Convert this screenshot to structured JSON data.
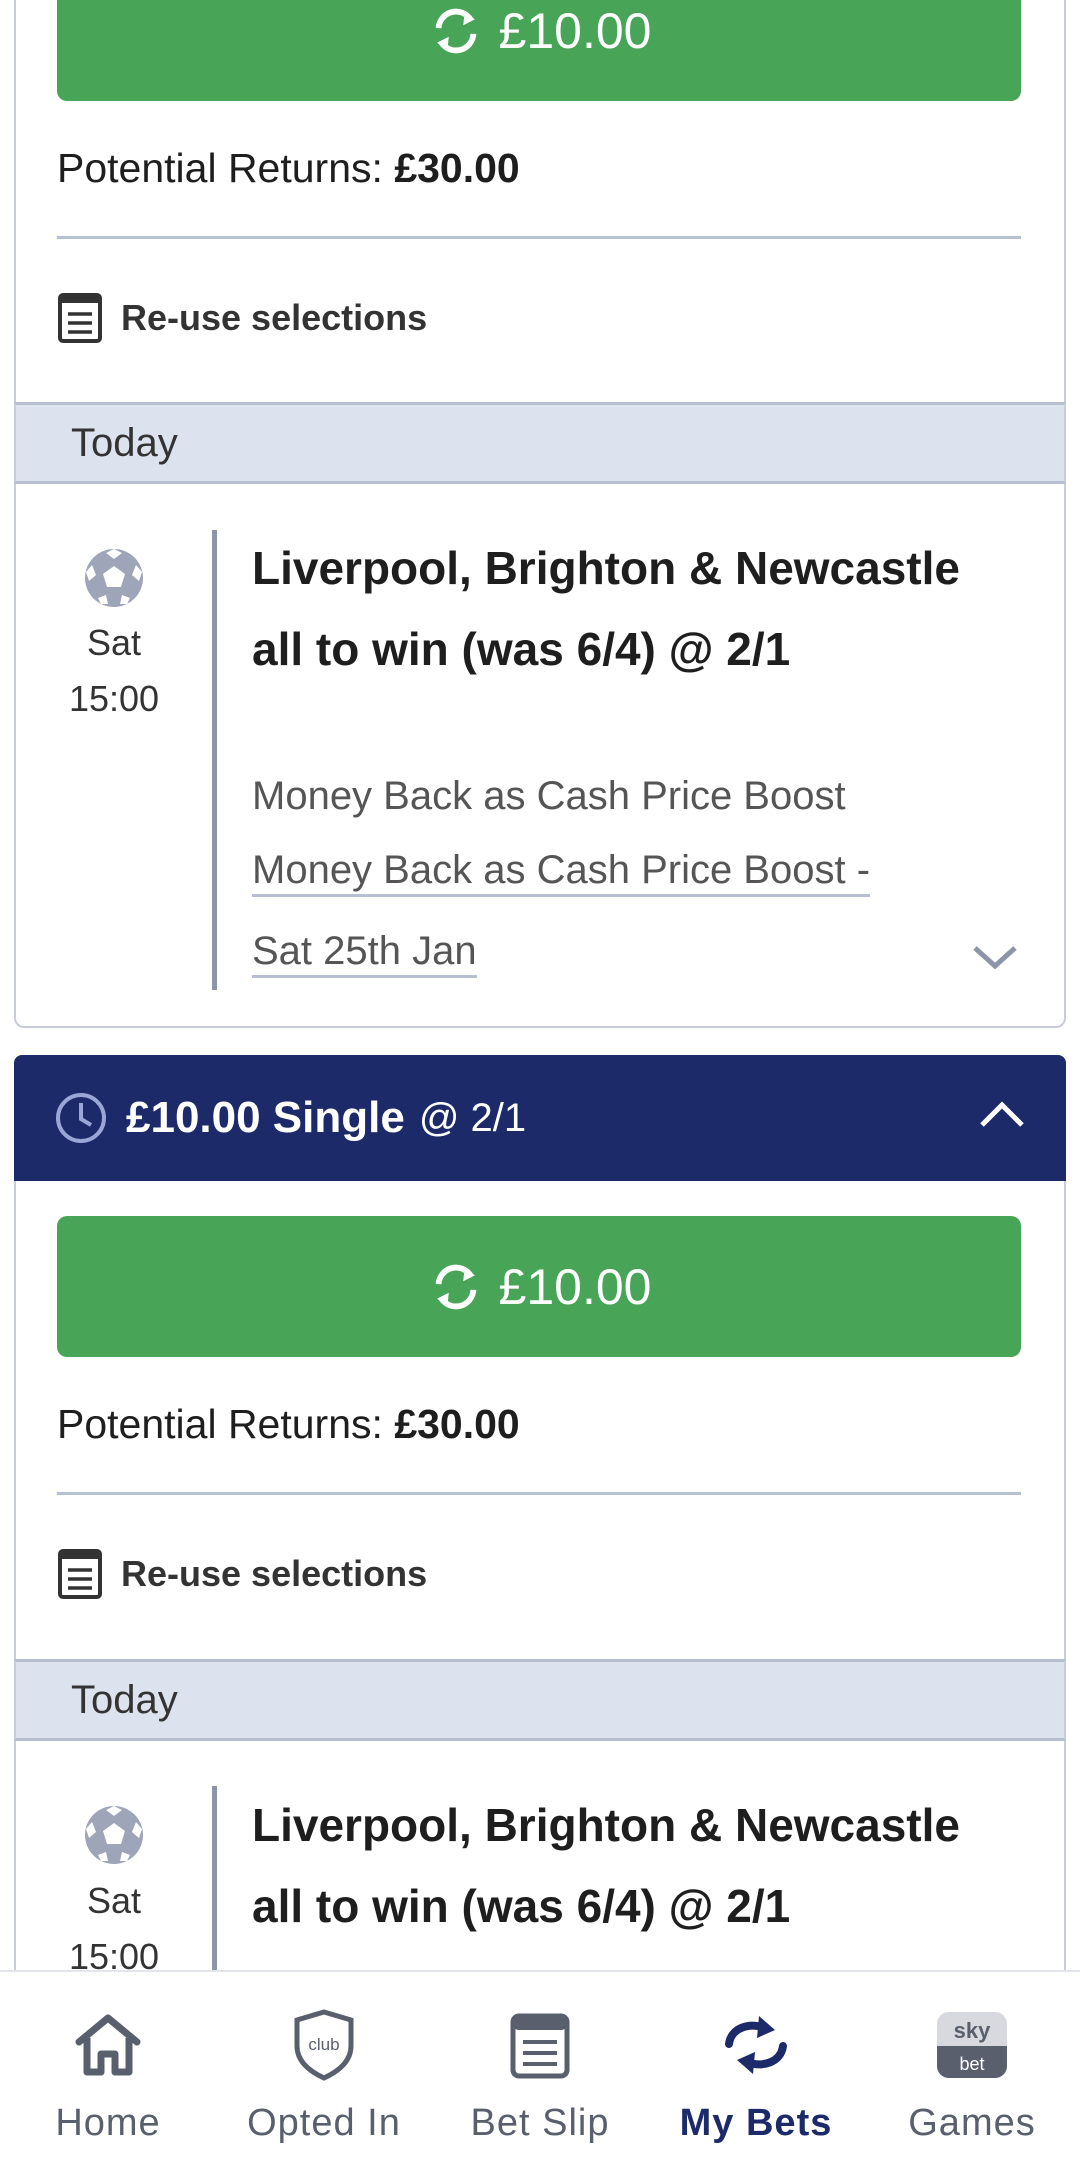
{
  "bets": [
    {
      "cashout_amount": "£10.00",
      "returns_label": "Potential Returns:",
      "returns_value": "£30.00",
      "reuse_label": "Re-use selections",
      "day_header": "Today",
      "selection": {
        "day": "Sat",
        "time": "15:00",
        "title": "Liverpool, Brighton & Newcastle all to win (was 6/4) @ 2/1",
        "market": "Money Back as Cash Price Boost",
        "event_link": "Money Back as Cash Price Boost - Sat 25th Jan"
      }
    },
    {
      "header_stake": "£10.00 Single",
      "header_odds": "@ 2/1",
      "cashout_amount": "£10.00",
      "returns_label": "Potential Returns:",
      "returns_value": "£30.00",
      "reuse_label": "Re-use selections",
      "day_header": "Today",
      "selection": {
        "day": "Sat",
        "time": "15:00",
        "title": "Liverpool, Brighton & Newcastle all to win (was 6/4) @ 2/1"
      }
    }
  ],
  "nav": {
    "items": [
      {
        "label": "Home",
        "icon": "home-icon"
      },
      {
        "label": "Opted In",
        "icon": "club-shield-icon",
        "icon_text": "club"
      },
      {
        "label": "Bet Slip",
        "icon": "bet-slip-icon"
      },
      {
        "label": "My Bets",
        "icon": "my-bets-icon",
        "active": true
      },
      {
        "label": "Games",
        "icon": "sky-bet-games-icon",
        "icon_text_top": "sky",
        "icon_text_bottom": "bet"
      }
    ]
  },
  "colors": {
    "green": "#48a456",
    "navy": "#1d2a6a",
    "today_bg": "#dde3ee"
  }
}
